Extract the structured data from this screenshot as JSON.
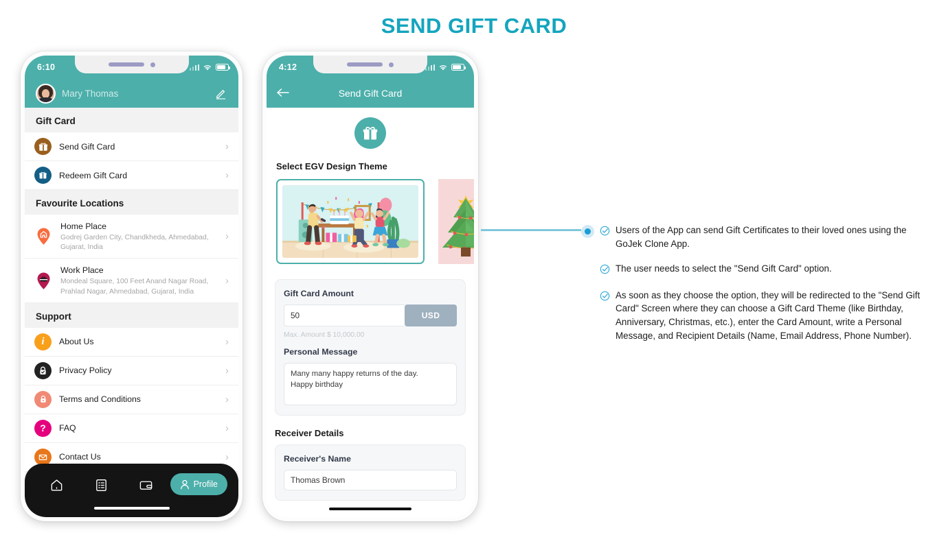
{
  "title": "SEND GIFT CARD",
  "theme": {
    "teal": "#4CAFAA",
    "title_color": "#14A5BE",
    "accent_blue": "#1A9ED4",
    "currency_btn": "#9FB0BF"
  },
  "phone_left": {
    "status": {
      "time": "6:10",
      "icons": [
        "signal-icon",
        "wifi-icon",
        "battery-icon"
      ]
    },
    "header": {
      "name": "Mary Thomas",
      "edit_icon": "pencil-icon",
      "avatar": "user-avatar"
    },
    "sections": [
      {
        "heading": "Gift Card",
        "items": [
          {
            "label": "Send Gift Card",
            "sub": "",
            "icon": "gift-icon",
            "color": "#9A5F1E"
          },
          {
            "label": "Redeem Gift Card",
            "sub": "",
            "icon": "redeem-gift-icon",
            "color": "#145E86"
          }
        ]
      },
      {
        "heading": "Favourite Locations",
        "items": [
          {
            "label": "Home Place",
            "sub": "Godrej Garden City, Chandkheda, Ahmedabad, Gujarat, India",
            "icon": "home-pin-icon",
            "color": "#F96C3F"
          },
          {
            "label": "Work Place",
            "sub": "Mondeal Square, 100 Feet Anand Nagar Road, Prahlad Nagar, Ahmedabad, Gujarat, India",
            "icon": "work-pin-icon",
            "color": "#B4194F"
          }
        ]
      },
      {
        "heading": "Support",
        "items": [
          {
            "label": "About Us",
            "sub": "",
            "icon": "info-icon",
            "color": "#F9A01B"
          },
          {
            "label": "Privacy Policy",
            "sub": "",
            "icon": "privacy-lock-icon",
            "color": "#222222"
          },
          {
            "label": "Terms and Conditions",
            "sub": "",
            "icon": "lock-icon",
            "color": "#F08A75"
          },
          {
            "label": "FAQ",
            "sub": "",
            "icon": "question-icon",
            "color": "#E5007E"
          },
          {
            "label": "Contact Us",
            "sub": "",
            "icon": "envelope-icon",
            "color": "#E8761A"
          }
        ]
      }
    ],
    "bottom_nav": {
      "items": [
        {
          "icon": "home-icon",
          "label": ""
        },
        {
          "icon": "orders-list-icon",
          "label": ""
        },
        {
          "icon": "wallet-icon",
          "label": ""
        }
      ],
      "profile": {
        "label": "Profile",
        "icon": "person-icon"
      }
    }
  },
  "phone_right": {
    "status": {
      "time": "4:12",
      "icons": [
        "signal-icon",
        "wifi-icon",
        "battery-icon"
      ]
    },
    "appbar": {
      "title": "Send Gift Card",
      "back_icon": "arrow-left-icon"
    },
    "hero_icon": "gift-icon",
    "theme_section_label": "Select EGV Design Theme",
    "themes": [
      {
        "name": "Birthday",
        "selected": true
      },
      {
        "name": "Christmas",
        "selected": false
      }
    ],
    "form": {
      "amount_label": "Gift Card Amount",
      "amount_value": "50",
      "currency": "USD",
      "amount_hint": "Max. Amount $ 10,000.00",
      "message_label": "Personal Message",
      "message_value": "Many many happy returns of the day.\nHappy birthday"
    },
    "receiver": {
      "section_label": "Receiver Details",
      "name_label": "Receiver's Name",
      "name_value": "Thomas Brown"
    }
  },
  "annotations": {
    "check_icon": "check-circle-icon",
    "items": [
      "Users of the App can send Gift Certificates to their loved ones using the GoJek Clone App.",
      "The user needs to select the \"Send Gift Card\" option.",
      "As soon as they choose the option, they will be redirected to the \"Send Gift Card\" Screen where they can choose a Gift Card Theme (like Birthday, Anniversary, Christmas, etc.), enter the Card Amount, write a Personal Message, and Recipient Details (Name, Email Address, Phone Number)."
    ]
  }
}
